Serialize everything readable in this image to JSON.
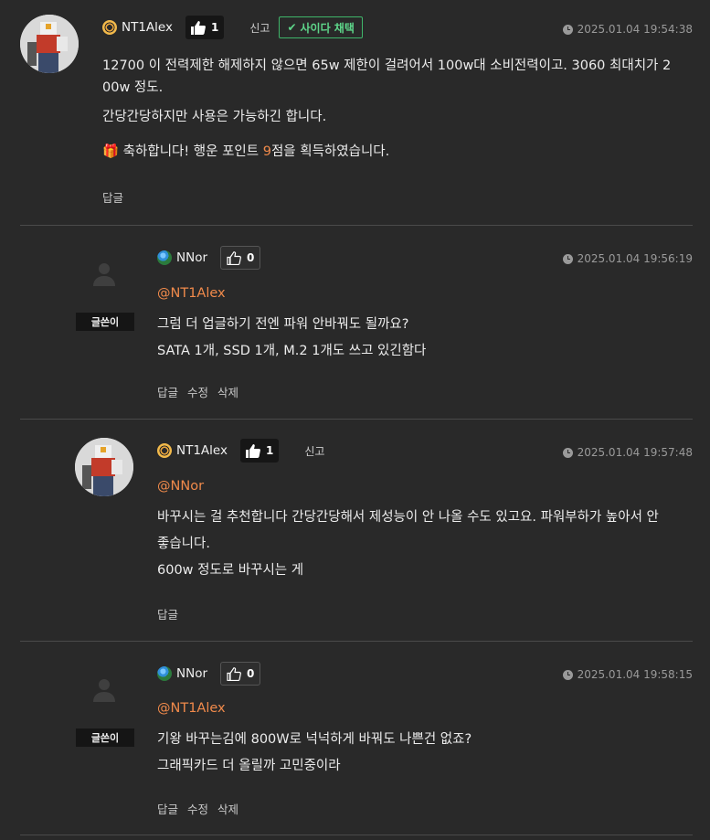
{
  "comments": [
    {
      "nick": "NT1Alex",
      "likes": "1",
      "report": "신고",
      "adopt": "사이다 채택",
      "date": "2025.01.04 19:54:38",
      "line1": "12700 이 전력제한 해제하지 않으면 65w 제한이 걸려어서 100w대 소비전력이고. 3060 최대치가 2",
      "line2": "00w 정도.",
      "line3": "간당간당하지만 사용은 가능하긴 합니다.",
      "bonus_prefix": "축하합니다! 행운 포인트 ",
      "bonus_points": "9",
      "bonus_suffix": "점을 획득하였습니다.",
      "reply": "답글"
    },
    {
      "nick": "NNor",
      "likes": "0",
      "badge": "글쓴이",
      "date": "2025.01.04 19:56:19",
      "mention": "@NT1Alex",
      "line1": "그럼 더 업글하기 전엔 파워 안바꿔도 될까요?",
      "line2": "SATA 1개, SSD 1개, M.2 1개도 쓰고 있긴함다",
      "reply": "답글",
      "edit": "수정",
      "delete": "삭제"
    },
    {
      "nick": "NT1Alex",
      "likes": "1",
      "report": "신고",
      "date": "2025.01.04 19:57:48",
      "mention": "@NNor",
      "line1": "바꾸시는 걸 추천합니다 간당간당해서 제성능이 안 나올 수도 있고요. 파워부하가 높아서 안",
      "line2": "좋습니다.",
      "line3": "600w 정도로 바꾸시는 게",
      "reply": "답글"
    },
    {
      "nick": "NNor",
      "likes": "0",
      "badge": "글쓴이",
      "date": "2025.01.04 19:58:15",
      "mention": "@NT1Alex",
      "line1": "기왕 바꾸는김에 800W로 넉넉하게 바꿔도 나쁜건 없죠?",
      "line2": "그래픽카드 더 올릴까 고민중이라",
      "reply": "답글",
      "edit": "수정",
      "delete": "삭제"
    }
  ],
  "colors": {
    "background": "#292929",
    "mention": "#f08a4b",
    "adopt": "#5ed68a"
  }
}
